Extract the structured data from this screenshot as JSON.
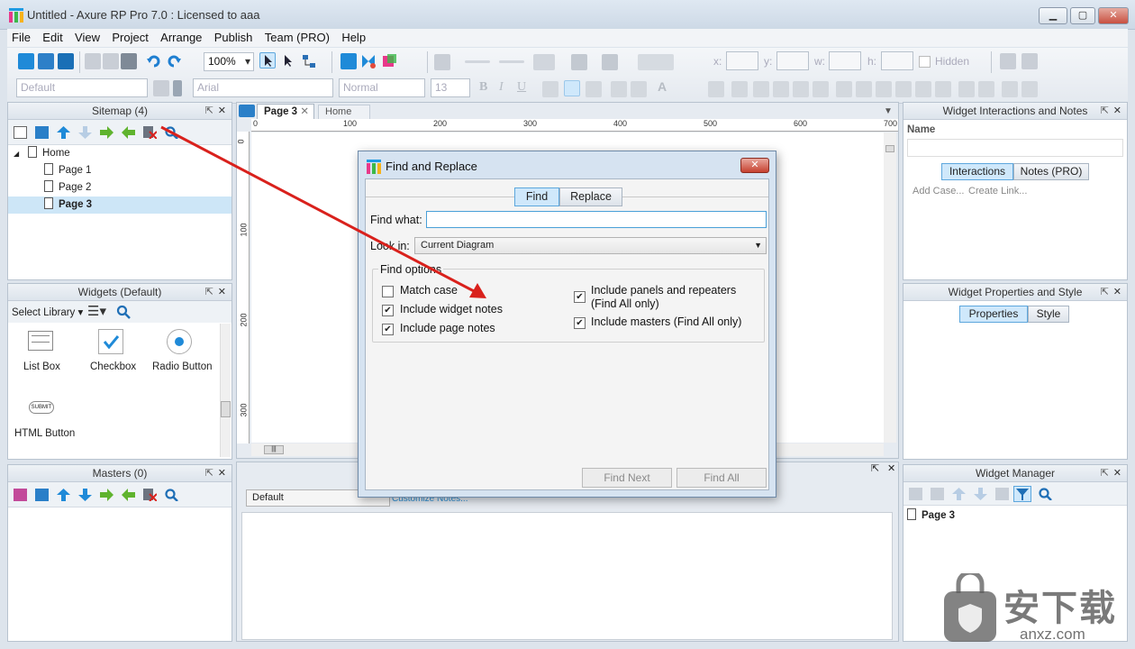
{
  "window": {
    "title": "Untitled - Axure RP Pro 7.0 : Licensed to aaa"
  },
  "menu": [
    "File",
    "Edit",
    "View",
    "Project",
    "Arrange",
    "Publish",
    "Team (PRO)",
    "Help"
  ],
  "toolbar": {
    "zoom": "100%",
    "style_combo": "Default",
    "font_combo": "Arial",
    "weight_combo": "Normal",
    "size_combo": "13",
    "x_label": "x:",
    "y_label": "y:",
    "w_label": "w:",
    "h_label": "h:",
    "hidden_label": "Hidden"
  },
  "sitemap": {
    "title": "Sitemap (4)",
    "home": "Home",
    "pages": [
      "Page 1",
      "Page 2",
      "Page 3"
    ],
    "selected": "Page 3"
  },
  "widgets": {
    "title": "Widgets (Default)",
    "select_library": "Select Library",
    "items": [
      "List Box",
      "Checkbox",
      "Radio Button",
      "HTML Button"
    ],
    "submit_glyph": "SUBMIT"
  },
  "masters": {
    "title": "Masters (0)"
  },
  "canvas": {
    "tabs": [
      "Page 3",
      "Home"
    ],
    "ruler_h": [
      "0",
      "100",
      "200",
      "300",
      "400",
      "500",
      "600",
      "700"
    ],
    "ruler_v": [
      "0",
      "100",
      "200",
      "300"
    ]
  },
  "notes": {
    "select": "Default",
    "customize": "Customize Notes..."
  },
  "interactions": {
    "title": "Widget Interactions and Notes",
    "name_label": "Name",
    "tabs": [
      "Interactions",
      "Notes (PRO)"
    ],
    "add_case": "Add Case...",
    "create_link": "Create Link..."
  },
  "properties": {
    "title": "Widget Properties and Style",
    "tabs": [
      "Properties",
      "Style"
    ]
  },
  "widget_manager": {
    "title": "Widget Manager",
    "page": "Page 3"
  },
  "dialog": {
    "title": "Find and Replace",
    "tabs": [
      "Find",
      "Replace"
    ],
    "find_what_label": "Find what:",
    "find_what_value": "",
    "look_in_label": "Look in:",
    "look_in_value": "Current Diagram",
    "options_title": "Find options",
    "options": [
      {
        "label": "Match case",
        "checked": false
      },
      {
        "label": "Include widget notes",
        "checked": true
      },
      {
        "label": "Include page notes",
        "checked": true
      },
      {
        "label": "Include panels and repeaters",
        "label2": "(Find All only)",
        "checked": true
      },
      {
        "label": "Include masters (Find All only)",
        "checked": true
      }
    ],
    "find_next": "Find Next",
    "find_all": "Find All"
  },
  "colors": {
    "accent": "#2a8fd6",
    "arrow": "#d9211c",
    "selection": "#cde6f7"
  },
  "watermark": {
    "text": "安下载",
    "sub": "anxz.com"
  }
}
